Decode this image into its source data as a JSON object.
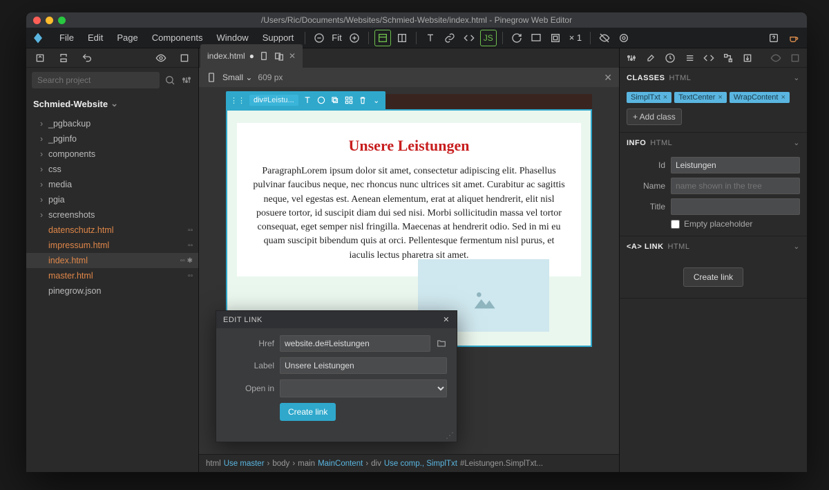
{
  "window": {
    "title": "/Users/Ric/Documents/Websites/Schmied-Website/index.html - Pinegrow Web Editor"
  },
  "menu": {
    "items": [
      "File",
      "Edit",
      "Page",
      "Components",
      "Window",
      "Support"
    ],
    "fit": "Fit",
    "x1": "× 1"
  },
  "search": {
    "placeholder": "Search project"
  },
  "project": {
    "name": "Schmied-Website",
    "folders": [
      "_pgbackup",
      "_pginfo",
      "components",
      "css",
      "media",
      "pgia",
      "screenshots"
    ],
    "files": [
      {
        "name": "datenschutz.html",
        "active": false,
        "plain": false,
        "acts": true
      },
      {
        "name": "impressum.html",
        "active": false,
        "plain": false,
        "acts": true
      },
      {
        "name": "index.html",
        "active": true,
        "plain": false,
        "acts": true,
        "star": true
      },
      {
        "name": "master.html",
        "active": false,
        "plain": false,
        "acts": true
      },
      {
        "name": "pinegrow.json",
        "active": false,
        "plain": true,
        "acts": false
      }
    ]
  },
  "tab": {
    "name": "index.html",
    "dirty": "●"
  },
  "viewport": {
    "size": "Small",
    "px": "609 px"
  },
  "selection": {
    "tag": "div",
    "id": "#Leistu..."
  },
  "content": {
    "heading": "Unsere Leistungen",
    "paragraph": "ParagraphLorem ipsum dolor sit amet, consectetur adipiscing elit. Phasellus pulvinar faucibus neque, nec rhoncus nunc ultrices sit amet. Curabitur ac sagittis neque, vel egestas est. Aenean elementum, erat at aliquet hendrerit, elit nisl posuere tortor, id suscipit diam dui sed nisi. Morbi sollicitudin massa vel tortor consequat, eget semper nisl fringilla. Maecenas at hendrerit odio. Sed in mi eu quam suscipit bibendum quis at orci. Pellentesque fermentum nisl purus, et iaculis lectus pharetra sit amet."
  },
  "editlink": {
    "title": "EDIT LINK",
    "href_label": "Href",
    "href_value": "website.de#Leistungen",
    "label_label": "Label",
    "label_value": "Unsere Leistungen",
    "openin_label": "Open in",
    "button": "Create link"
  },
  "breadcrumb": {
    "parts": [
      {
        "text": "html",
        "blue": ""
      },
      {
        "text": "Use master",
        "blue": "1"
      },
      {
        "text": "body",
        "blue": ""
      },
      {
        "text": "main",
        "blue": ""
      },
      {
        "text": "MainContent",
        "blue": "1"
      },
      {
        "text": "div",
        "blue": ""
      },
      {
        "text": "Use comp., SimplTxt",
        "blue": "1"
      },
      {
        "text": "#Leistungen.SimplTxt...",
        "blue": ""
      }
    ]
  },
  "classes": {
    "label": "CLASSES",
    "sub": "HTML",
    "items": [
      "SimplTxt",
      "TextCenter",
      "WrapContent"
    ],
    "add": "+ Add class"
  },
  "info": {
    "label": "INFO",
    "sub": "HTML",
    "id_label": "Id",
    "id_value": "Leistungen",
    "name_label": "Name",
    "name_placeholder": "name shown in the tree",
    "title_label": "Title",
    "empty": "Empty placeholder"
  },
  "linkpanel": {
    "label": "<A> LINK",
    "sub": "HTML",
    "button": "Create link"
  }
}
